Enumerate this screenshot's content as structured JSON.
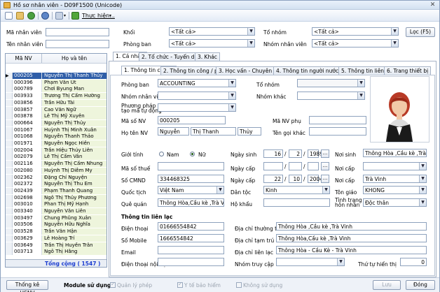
{
  "window": {
    "title": "Hồ sơ nhân viên - D09F1500 (Unicode)",
    "close": "✕"
  },
  "toolbar": {
    "utilities_label": "Thực hiện..."
  },
  "filters": {
    "employee_id_label": "Mã nhân viên",
    "employee_name_label": "Tên nhân viên",
    "block_label": "Khối",
    "block_value": "<Tất cả>",
    "department_label": "Phòng ban",
    "department_value": "<Tất cả>",
    "group_label": "Tổ nhóm",
    "group_value": "<Tất cả>",
    "employee_group_label": "Nhóm nhân viên",
    "employee_group_value": "<Tất cả>",
    "load_button": "Lọc (F5)"
  },
  "grid": {
    "col_id": "Mã NV",
    "col_name": "Họ và tên",
    "rows": [
      {
        "id": "000205",
        "name": "Nguyễn Thị Thanh Thủy"
      },
      {
        "id": "000396",
        "name": "Phạm Văn Út"
      },
      {
        "id": "000789",
        "name": "Chơi Byung Man"
      },
      {
        "id": "003933",
        "name": "Trương Thị Cẩm Hường"
      },
      {
        "id": "003856",
        "name": "Trần Hữu Tài"
      },
      {
        "id": "003857",
        "name": "Cao Văn Ngữ"
      },
      {
        "id": "003878",
        "name": "Lê Thị Mỹ Xuyên"
      },
      {
        "id": "000664",
        "name": "Nguyễn Thị Thủy"
      },
      {
        "id": "001067",
        "name": "Huỳnh Thị Minh Xuân"
      },
      {
        "id": "001068",
        "name": "Nguyễn Thanh Thảo"
      },
      {
        "id": "001971",
        "name": "Nguyễn Ngọc Hiền"
      },
      {
        "id": "002004",
        "name": "Trần Hiệu Thúy Liên"
      },
      {
        "id": "002079",
        "name": "Lê Thị Cẩm Vân"
      },
      {
        "id": "002116",
        "name": "Nguyễn Thị Cẩm Nhung"
      },
      {
        "id": "002080",
        "name": "Huỳnh Thị Diễm My"
      },
      {
        "id": "002362",
        "name": "Đặng Chí Nguyện"
      },
      {
        "id": "002372",
        "name": "Nguyễn Thị Thu Em"
      },
      {
        "id": "002439",
        "name": "Phạm Thanh Quang"
      },
      {
        "id": "002698",
        "name": "Ngô Thị Thủy Phương"
      },
      {
        "id": "003010",
        "name": "Phan Thị Mỹ Hạnh"
      },
      {
        "id": "003340",
        "name": "Nguyễn Văn Liên"
      },
      {
        "id": "003497",
        "name": "Chung Phũng Xuân"
      },
      {
        "id": "003506",
        "name": "Nguyễn Hữu Nghĩa"
      },
      {
        "id": "003528",
        "name": "Trần Văn Hận"
      },
      {
        "id": "003629",
        "name": "Lê Hoàng Trí"
      },
      {
        "id": "003649",
        "name": "Trần Thị Huyền Trân"
      },
      {
        "id": "003713",
        "name": "Ngô Thị Hằng"
      }
    ],
    "total_label": "Tổng cộng ( 1547 )"
  },
  "tabs_main": [
    "1. Cá nhân",
    "2. Tổ chức - Tuyển dụng",
    "3. Khác"
  ],
  "tabs_sub": [
    "1. Thông tin chung",
    "2. Thông tin công / phép",
    "3. Học vấn - Chuyên môn",
    "4. Thông tin người nước ngoài",
    "5. Thông tin liên hệ",
    "6. Trang thiết bị"
  ],
  "form": {
    "department_label": "Phòng ban",
    "department_value": "ACCOUNTING",
    "group_label": "Tổ nhóm",
    "employee_group_label": "Nhóm nhân viên",
    "other_group_label": "Nhóm khác",
    "method_label_1": "Phương pháp",
    "method_label_2": "tạo mã tự động",
    "emp_code_label": "Mã số NV",
    "emp_code_value": "000205",
    "emp_sub_code_label": "Mã NV phụ",
    "full_name_label": "Họ tên NV",
    "last_name": "Nguyễn",
    "middle_name": "Thị Thanh",
    "first_name": "Thủy",
    "alias_label": "Tên gọi khác",
    "gender_label": "Giới tính",
    "male_label": "Nam",
    "female_label": "Nữ",
    "birth_label": "Ngày sinh",
    "birth_day": "16",
    "birth_month": "2",
    "birth_year": "1989",
    "birth_place_label": "Nơi sinh",
    "birth_place_value": "Thông Hòa ,Cầu kè ,Trà Vinh",
    "tax_label": "Mã số thuế",
    "issue_date_label": "Ngày cấp",
    "issue_place_label": "Nơi cấp",
    "id_card_label": "Số CMND",
    "id_card_value": "334468325",
    "id_issue_date_label": "Ngày cấp",
    "id_day": "22",
    "id_month": "10",
    "id_year": "2004",
    "id_issue_place_label": "Nơi cấp",
    "id_issue_place_value": "Trà Vinh",
    "nationality_label": "Quốc tịch",
    "nationality_value": "Việt Nam",
    "ethnic_label": "Dân tộc",
    "ethnic_value": "Kinh",
    "religion_label": "Tôn giáo",
    "religion_value": "KHONG",
    "hometown_label": "Quê quán",
    "hometown_value": "Thông Hòa,Cầu kè ,Trà Vinh",
    "household_label": "Hộ khẩu",
    "marital_label_1": "Tình trạng",
    "marital_label_2": "hôn nhân",
    "marital_value": "Độc thân",
    "contact_header": "Thông tin liên lạc",
    "phone_label": "Điện thoại",
    "phone_value": "01666554842",
    "mobile_label": "Số Mobile",
    "mobile_value": "1666554842",
    "email_label": "Email",
    "ext_label": "Điện thoại nội bộ",
    "perm_addr_label": "Địa chỉ thường trú",
    "perm_addr_value": "Thông Hòa ,Cầu kè ,Trà Vinh",
    "temp_addr_label": "Địa chỉ tạm trú",
    "temp_addr_value": "Thông Hòa,Cầu kè ,Trà Vinh",
    "contact_addr_label": "Địa chỉ liên lạc",
    "contact_addr_value": "Thông Hòa - Cầu Kè - Trà Vinh",
    "access_group_label": "Nhóm truy cập",
    "display_order_label": "Thứ tự hiển thị",
    "display_order_value": "0"
  },
  "bottom": {
    "stats_button": "Thống kê HSNV",
    "module_label": "Module sử dụng",
    "leave_label": "Quản lý phép",
    "insurance_label": "Y tế bảo hiểm",
    "unused_label": "Không sử dụng",
    "save_button": "Lưu",
    "close_button": "Đóng"
  }
}
